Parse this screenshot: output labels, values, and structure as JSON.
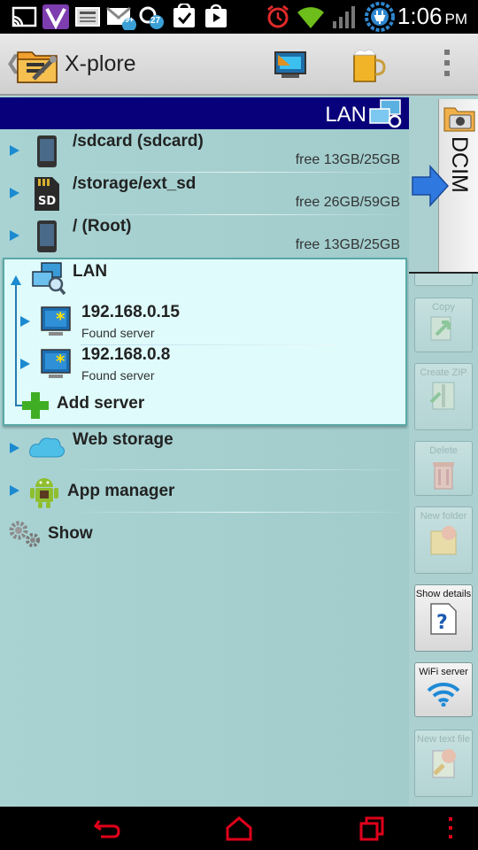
{
  "status_bar": {
    "time": "1:06",
    "ampm": "PM",
    "badge_mail": "99+",
    "badge_count": "27",
    "icons": [
      "cast-icon",
      "viber-icon",
      "news-icon",
      "gmail-icon",
      "chat-icon",
      "tasks-icon",
      "play-store-icon",
      "alarm-icon",
      "wifi-icon",
      "signal-icon",
      "battery-charging-icon"
    ]
  },
  "app_bar": {
    "title": "X-plore",
    "actions": [
      "dual-pane-icon",
      "beer-donate-icon",
      "overflow-menu-icon"
    ]
  },
  "left_pane": {
    "header": "LAN",
    "storage": [
      {
        "name": "/sdcard (sdcard)",
        "free": "free 13GB/25GB"
      },
      {
        "name": "/storage/ext_sd",
        "free": "free 26GB/59GB"
      },
      {
        "name": "/ (Root)",
        "free": "free 13GB/25GB"
      }
    ],
    "lan": {
      "label": "LAN",
      "servers": [
        {
          "ip": "192.168.0.15",
          "status": "Found server"
        },
        {
          "ip": "192.168.0.8",
          "status": "Found server"
        }
      ],
      "add_label": "Add server"
    },
    "items": [
      {
        "label": "Web storage"
      },
      {
        "label": "App manager"
      },
      {
        "label": "Show"
      }
    ]
  },
  "right_pane": {
    "tab_label": "DCIM",
    "buttons": [
      {
        "label": "Copy",
        "enabled": false
      },
      {
        "label": "Create ZIP",
        "enabled": false
      },
      {
        "label": "Delete",
        "enabled": false
      },
      {
        "label": "New folder",
        "enabled": false
      },
      {
        "label": "Show details",
        "enabled": true
      },
      {
        "label": "WiFi server",
        "enabled": true
      },
      {
        "label": "New text file",
        "enabled": false
      }
    ]
  },
  "nav_bar": {
    "icons": [
      "back-icon",
      "home-icon",
      "recent-apps-icon",
      "overflow-icon"
    ],
    "color": "#e0001a"
  }
}
